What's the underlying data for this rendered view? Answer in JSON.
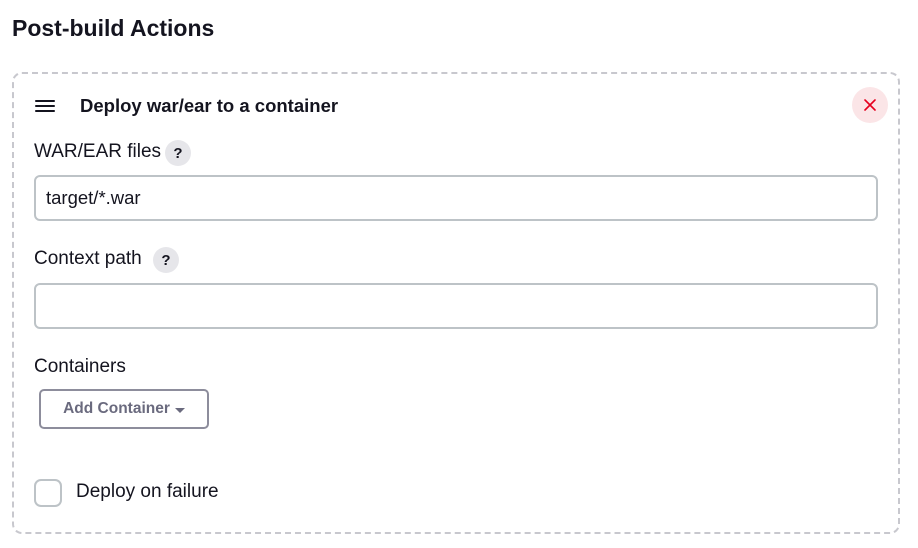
{
  "section": {
    "title": "Post-build Actions"
  },
  "card": {
    "title": "Deploy war/ear to a container",
    "icons": {
      "drag": "drag-handle-icon",
      "delete": "close-icon"
    },
    "colors": {
      "delete_bg": "#fbe5e7",
      "delete_icon": "#e6001f"
    }
  },
  "fields": {
    "war_files": {
      "label": "WAR/EAR files",
      "help": "?",
      "value": "target/*.war"
    },
    "context_path": {
      "label": "Context path",
      "help": "?",
      "value": ""
    },
    "containers": {
      "label": "Containers",
      "button_label": "Add Container"
    },
    "deploy_on_failure": {
      "label": "Deploy on failure",
      "checked": false
    }
  }
}
